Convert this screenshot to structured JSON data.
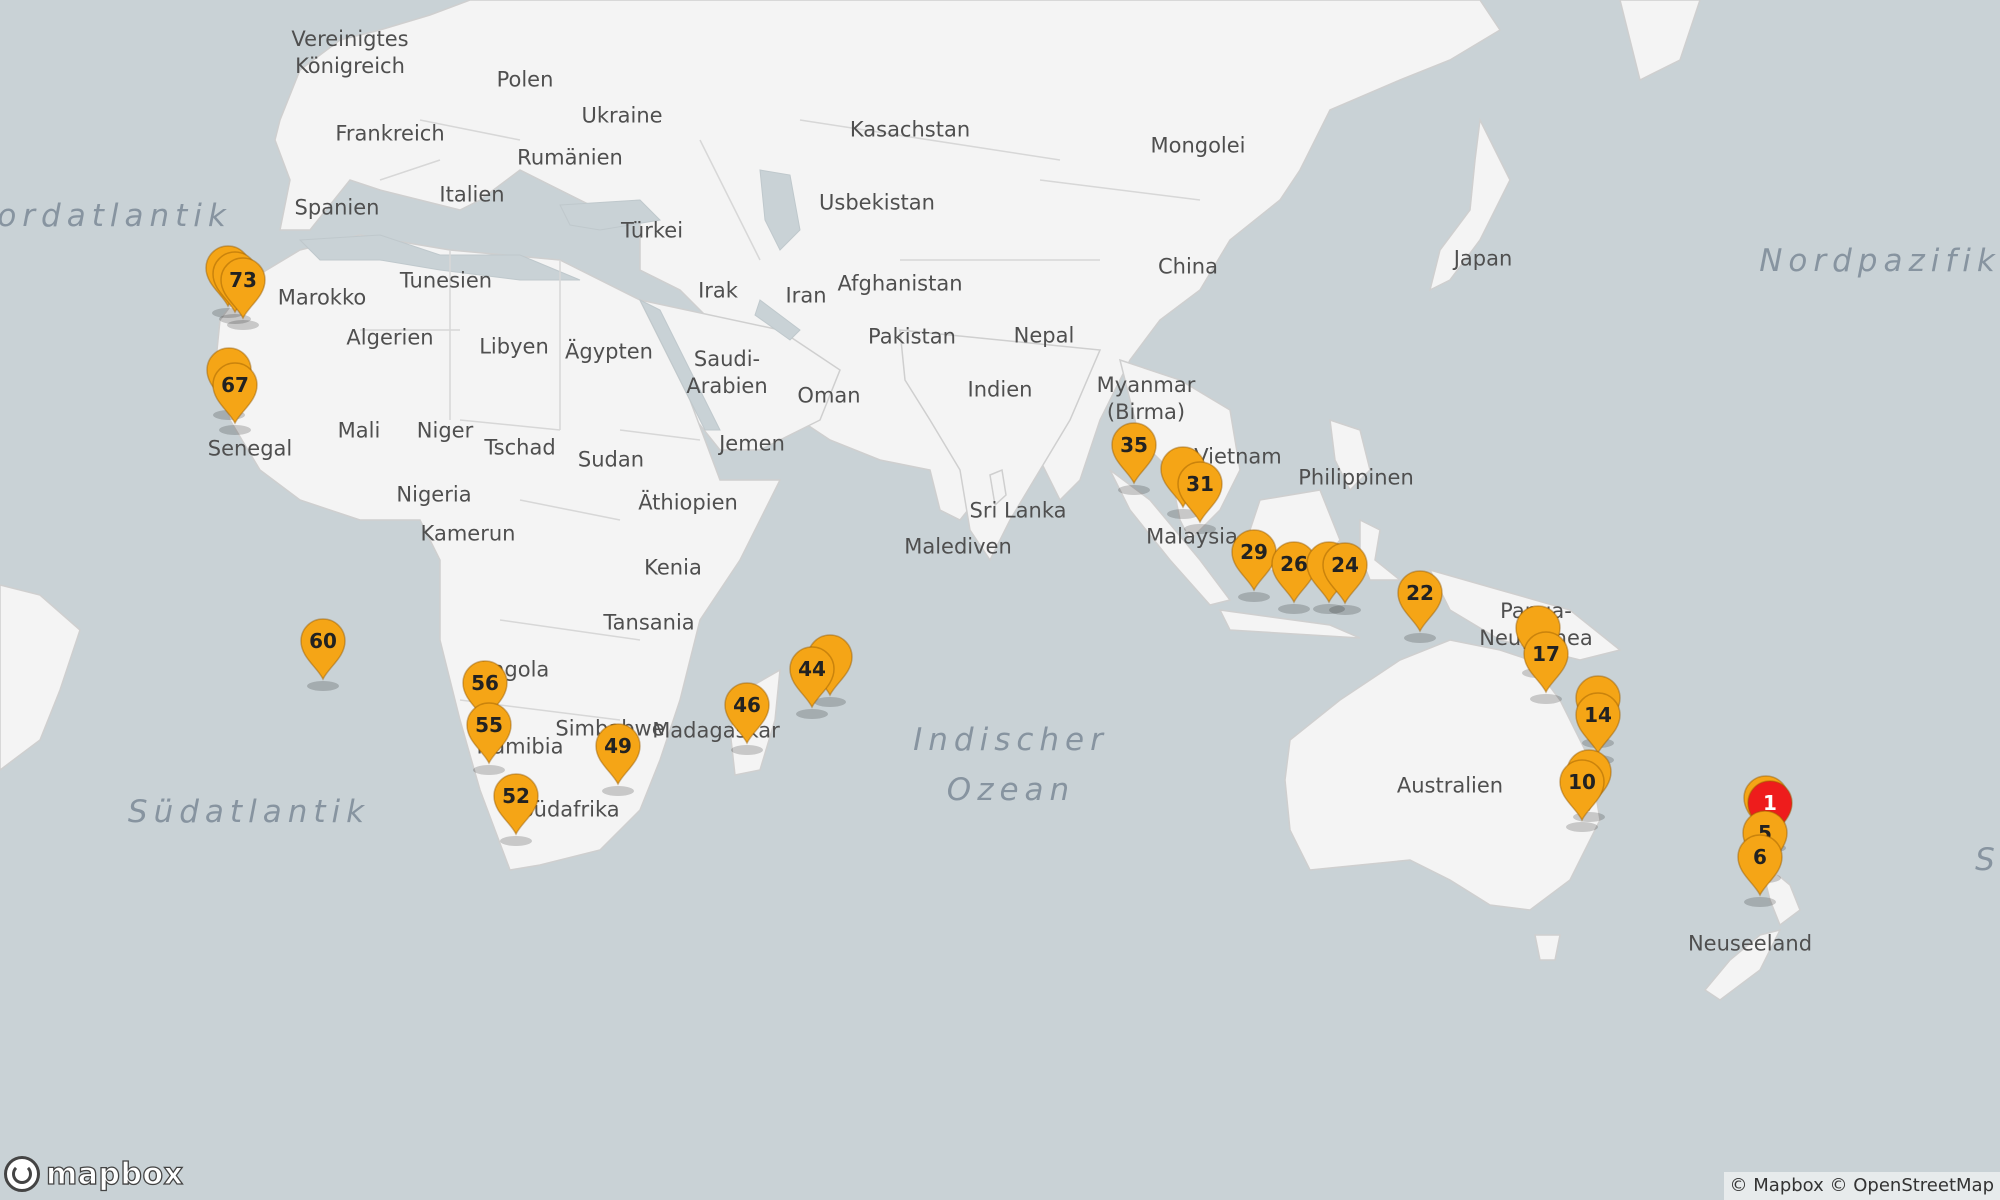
{
  "countries": [
    {
      "lines": [
        "Vereinigtes",
        "Königreich"
      ]
    },
    {
      "lines": [
        "Polen"
      ]
    },
    {
      "lines": [
        "Ukraine"
      ]
    },
    {
      "lines": [
        "Frankreich"
      ]
    },
    {
      "lines": [
        "Rumänien"
      ]
    },
    {
      "lines": [
        "Kasachstan"
      ]
    },
    {
      "lines": [
        "Mongolei"
      ]
    },
    {
      "lines": [
        "Spanien"
      ]
    },
    {
      "lines": [
        "Italien"
      ]
    },
    {
      "lines": [
        "Usbekistan"
      ]
    },
    {
      "lines": [
        "Türkei"
      ]
    },
    {
      "lines": [
        "Japan"
      ]
    },
    {
      "lines": [
        "China"
      ]
    },
    {
      "lines": [
        "Tunesien"
      ]
    },
    {
      "lines": [
        "Marokko"
      ]
    },
    {
      "lines": [
        "Afghanistan"
      ]
    },
    {
      "lines": [
        "Irak"
      ]
    },
    {
      "lines": [
        "Iran"
      ]
    },
    {
      "lines": [
        "Algerien"
      ]
    },
    {
      "lines": [
        "Libyen"
      ]
    },
    {
      "lines": [
        "Ägypten"
      ]
    },
    {
      "lines": [
        "Pakistan"
      ]
    },
    {
      "lines": [
        "Nepal"
      ]
    },
    {
      "lines": [
        "Saudi-",
        "Arabien"
      ]
    },
    {
      "lines": [
        "Indien"
      ]
    },
    {
      "lines": [
        "Oman"
      ]
    },
    {
      "lines": [
        "Myanmar",
        "(Birma)"
      ]
    },
    {
      "lines": [
        "Mali"
      ]
    },
    {
      "lines": [
        "Niger"
      ]
    },
    {
      "lines": [
        "Tschad"
      ]
    },
    {
      "lines": [
        "Sudan"
      ]
    },
    {
      "lines": [
        "Jemen"
      ]
    },
    {
      "lines": [
        "Senegal"
      ]
    },
    {
      "lines": [
        "Vietnam"
      ]
    },
    {
      "lines": [
        "Philippinen"
      ]
    },
    {
      "lines": [
        "Nigeria"
      ]
    },
    {
      "lines": [
        "Äthiopien"
      ]
    },
    {
      "lines": [
        "Sri Lanka"
      ]
    },
    {
      "lines": [
        "Kamerun"
      ]
    },
    {
      "lines": [
        "Malaysia"
      ]
    },
    {
      "lines": [
        "Malediven"
      ]
    },
    {
      "lines": [
        "Kenia"
      ]
    },
    {
      "lines": [
        "Tansania"
      ]
    },
    {
      "lines": [
        "Papua-",
        "Neuguinea"
      ]
    },
    {
      "lines": [
        "Angola"
      ]
    },
    {
      "lines": [
        "Namibia"
      ]
    },
    {
      "lines": [
        "Simbabwe"
      ]
    },
    {
      "lines": [
        "Madagaskar"
      ]
    },
    {
      "lines": [
        "Australien"
      ]
    },
    {
      "lines": [
        "Südafrika"
      ]
    },
    {
      "lines": [
        "Neuseeland"
      ]
    }
  ],
  "oceans": [
    {
      "lines": [
        "Nordatlantik"
      ]
    },
    {
      "lines": [
        "Nordpazifik"
      ]
    },
    {
      "lines": [
        "Indischer",
        "Ozean"
      ]
    },
    {
      "lines": [
        "Südatlantik"
      ]
    },
    {
      "lines": [
        "S"
      ]
    }
  ],
  "markers": [
    {
      "label": "",
      "color": "#f5a516"
    },
    {
      "label": "",
      "color": "#f5a516"
    },
    {
      "label": "73",
      "color": "#f5a516"
    },
    {
      "label": "",
      "color": "#f5a516"
    },
    {
      "label": "67",
      "color": "#f5a516"
    },
    {
      "label": "60",
      "color": "#f5a516"
    },
    {
      "label": "56",
      "color": "#f5a516"
    },
    {
      "label": "55",
      "color": "#f5a516"
    },
    {
      "label": "52",
      "color": "#f5a516"
    },
    {
      "label": "49",
      "color": "#f5a516"
    },
    {
      "label": "",
      "color": "#f5a516"
    },
    {
      "label": "44",
      "color": "#f5a516"
    },
    {
      "label": "46",
      "color": "#f5a516"
    },
    {
      "label": "35",
      "color": "#f5a516"
    },
    {
      "label": "",
      "color": "#f5a516"
    },
    {
      "label": "31",
      "color": "#f5a516"
    },
    {
      "label": "29",
      "color": "#f5a516"
    },
    {
      "label": "26",
      "color": "#f5a516"
    },
    {
      "label": "",
      "color": "#f5a516"
    },
    {
      "label": "24",
      "color": "#f5a516"
    },
    {
      "label": "22",
      "color": "#f5a516"
    },
    {
      "label": "",
      "color": "#f5a516"
    },
    {
      "label": "17",
      "color": "#f5a516"
    },
    {
      "label": "",
      "color": "#f5a516"
    },
    {
      "label": "14",
      "color": "#f5a516"
    },
    {
      "label": "",
      "color": "#f5a516"
    },
    {
      "label": "10",
      "color": "#f5a516"
    },
    {
      "label": "",
      "color": "#f5a516"
    },
    {
      "label": "1",
      "color": "#ee1c1c"
    },
    {
      "label": "5",
      "color": "#f5a516"
    },
    {
      "label": "6",
      "color": "#f5a516"
    }
  ],
  "logo_text": "mapbox",
  "attribution": {
    "mapbox": "© Mapbox",
    "osm": "© OpenStreetMap"
  }
}
